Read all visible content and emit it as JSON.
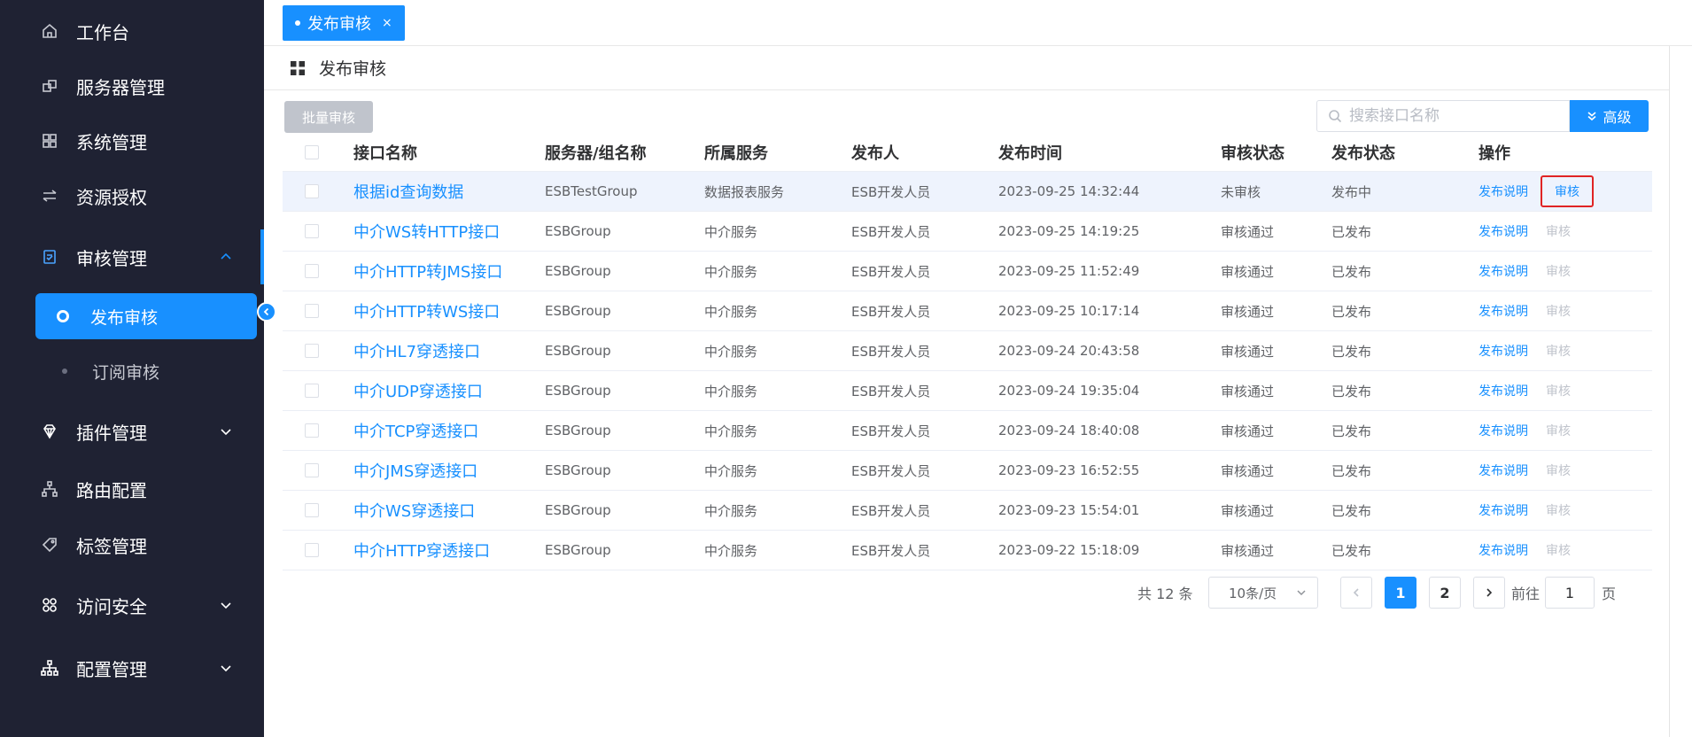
{
  "sidebar": {
    "items": [
      {
        "label": "工作台",
        "icon": "home-icon"
      },
      {
        "label": "服务器管理",
        "icon": "server-icon"
      },
      {
        "label": "系统管理",
        "icon": "grid-icon"
      },
      {
        "label": "资源授权",
        "icon": "transfer-icon"
      },
      {
        "label": "审核管理",
        "icon": "audit-icon"
      },
      {
        "label": "插件管理",
        "icon": "diamond-icon"
      },
      {
        "label": "路由配置",
        "icon": "route-icon"
      },
      {
        "label": "标签管理",
        "icon": "tag-icon"
      },
      {
        "label": "访问安全",
        "icon": "security-icon"
      },
      {
        "label": "配置管理",
        "icon": "sitemap-icon"
      }
    ],
    "sub_items": [
      {
        "label": "发布审核"
      },
      {
        "label": "订阅审核"
      }
    ]
  },
  "tabs": {
    "active": {
      "label": "发布审核",
      "close": "×"
    }
  },
  "page": {
    "title": "发布审核"
  },
  "toolbar": {
    "batch_label": "批量审核",
    "search_placeholder": "搜索接口名称",
    "advanced_label": "高级"
  },
  "table": {
    "columns": [
      "接口名称",
      "服务器/组名称",
      "所属服务",
      "发布人",
      "发布时间",
      "审核状态",
      "发布状态",
      "操作"
    ],
    "rows": [
      {
        "name": "根据id查询数据",
        "group": "ESBTestGroup",
        "service": "数据报表服务",
        "publisher": "ESB开发人员",
        "time": "2023-09-25 14:32:44",
        "audit": "未审核",
        "pstatus": "发布中",
        "op1": "发布说明",
        "op2": "审核"
      },
      {
        "name": "中介WS转HTTP接口",
        "group": "ESBGroup",
        "service": "中介服务",
        "publisher": "ESB开发人员",
        "time": "2023-09-25 14:19:25",
        "audit": "审核通过",
        "pstatus": "已发布",
        "op1": "发布说明",
        "op2": "审核"
      },
      {
        "name": "中介HTTP转JMS接口",
        "group": "ESBGroup",
        "service": "中介服务",
        "publisher": "ESB开发人员",
        "time": "2023-09-25 11:52:49",
        "audit": "审核通过",
        "pstatus": "已发布",
        "op1": "发布说明",
        "op2": "审核"
      },
      {
        "name": "中介HTTP转WS接口",
        "group": "ESBGroup",
        "service": "中介服务",
        "publisher": "ESB开发人员",
        "time": "2023-09-25 10:17:14",
        "audit": "审核通过",
        "pstatus": "已发布",
        "op1": "发布说明",
        "op2": "审核"
      },
      {
        "name": "中介HL7穿透接口",
        "group": "ESBGroup",
        "service": "中介服务",
        "publisher": "ESB开发人员",
        "time": "2023-09-24 20:43:58",
        "audit": "审核通过",
        "pstatus": "已发布",
        "op1": "发布说明",
        "op2": "审核"
      },
      {
        "name": "中介UDP穿透接口",
        "group": "ESBGroup",
        "service": "中介服务",
        "publisher": "ESB开发人员",
        "time": "2023-09-24 19:35:04",
        "audit": "审核通过",
        "pstatus": "已发布",
        "op1": "发布说明",
        "op2": "审核"
      },
      {
        "name": "中介TCP穿透接口",
        "group": "ESBGroup",
        "service": "中介服务",
        "publisher": "ESB开发人员",
        "time": "2023-09-24 18:40:08",
        "audit": "审核通过",
        "pstatus": "已发布",
        "op1": "发布说明",
        "op2": "审核"
      },
      {
        "name": "中介JMS穿透接口",
        "group": "ESBGroup",
        "service": "中介服务",
        "publisher": "ESB开发人员",
        "time": "2023-09-23 16:52:55",
        "audit": "审核通过",
        "pstatus": "已发布",
        "op1": "发布说明",
        "op2": "审核"
      },
      {
        "name": "中介WS穿透接口",
        "group": "ESBGroup",
        "service": "中介服务",
        "publisher": "ESB开发人员",
        "time": "2023-09-23 15:54:01",
        "audit": "审核通过",
        "pstatus": "已发布",
        "op1": "发布说明",
        "op2": "审核"
      },
      {
        "name": "中介HTTP穿透接口",
        "group": "ESBGroup",
        "service": "中介服务",
        "publisher": "ESB开发人员",
        "time": "2023-09-22 15:18:09",
        "audit": "审核通过",
        "pstatus": "已发布",
        "op1": "发布说明",
        "op2": "审核"
      }
    ]
  },
  "pagination": {
    "total_text": "共 12 条",
    "page_size": "10条/页",
    "pages": [
      "1",
      "2"
    ],
    "current": "1",
    "goto_prefix": "前往",
    "goto_value": "1",
    "goto_suffix": "页"
  },
  "colors": {
    "sidebar_bg": "#1f2233",
    "accent": "#1890ff",
    "highlight_row": "#eef3fd",
    "annotation_red": "#e02424"
  }
}
